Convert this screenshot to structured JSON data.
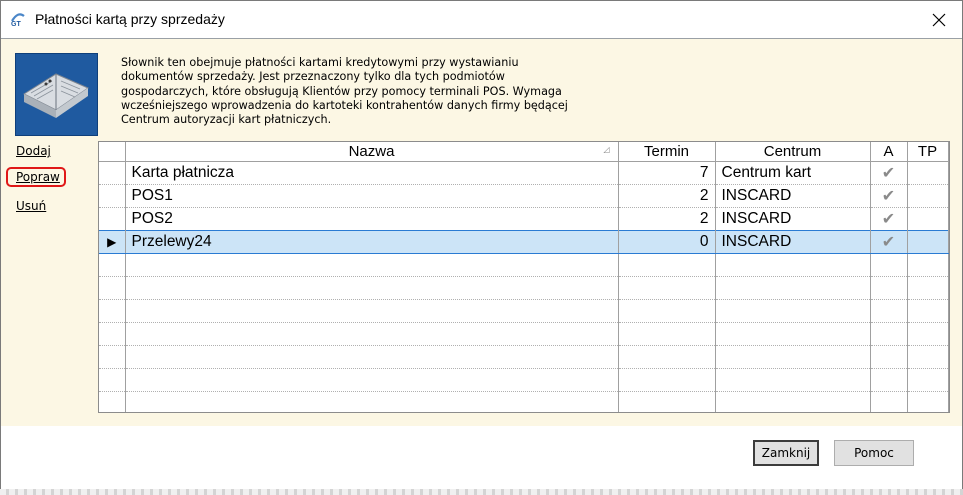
{
  "window": {
    "title": "Płatności kartą przy sprzedaży",
    "app_icon": "gt-logo-icon",
    "close_icon": "close-icon"
  },
  "description": "Słownik ten obejmuje płatności kartami kredytowymi przy wystawianiu\ndokumentów sprzedaży. Jest przeznaczony tylko dla tych podmiotów\ngospodarczych, które obsługują Klientów przy pomocy terminali POS. Wymaga\nwcześniejszego wprowadzenia do kartoteki kontrahentów danych firmy będącej\nCentrum autoryzacji kart płatniczych.",
  "dictionary_icon": "book-icon",
  "actions": {
    "add": "Dodaj",
    "edit": "Popraw",
    "delete": "Usuń"
  },
  "grid": {
    "columns": [
      "Nazwa",
      "Termin",
      "Centrum",
      "A",
      "TP"
    ],
    "sort_indicator": "sort-icon",
    "rows": [
      {
        "nazwa": "Karta płatnicza",
        "termin": "7",
        "centrum": "Centrum kart",
        "a": "✔",
        "tp": "",
        "selected": false
      },
      {
        "nazwa": "POS1",
        "termin": "2",
        "centrum": "INSCARD",
        "a": "✔",
        "tp": "",
        "selected": false
      },
      {
        "nazwa": "POS2",
        "termin": "2",
        "centrum": "INSCARD",
        "a": "✔",
        "tp": "",
        "selected": false
      },
      {
        "nazwa": "Przelewy24",
        "termin": "0",
        "centrum": "INSCARD",
        "a": "✔",
        "tp": "",
        "selected": true
      }
    ],
    "current_row_marker": "▶"
  },
  "buttons": {
    "close": "Zamknij",
    "help": "Pomoc"
  },
  "colors": {
    "panel_bg": "#fcf7e4",
    "selection_bg": "#cce4f7",
    "selection_border": "#2a7bd3",
    "highlight_ring": "#e01818"
  }
}
